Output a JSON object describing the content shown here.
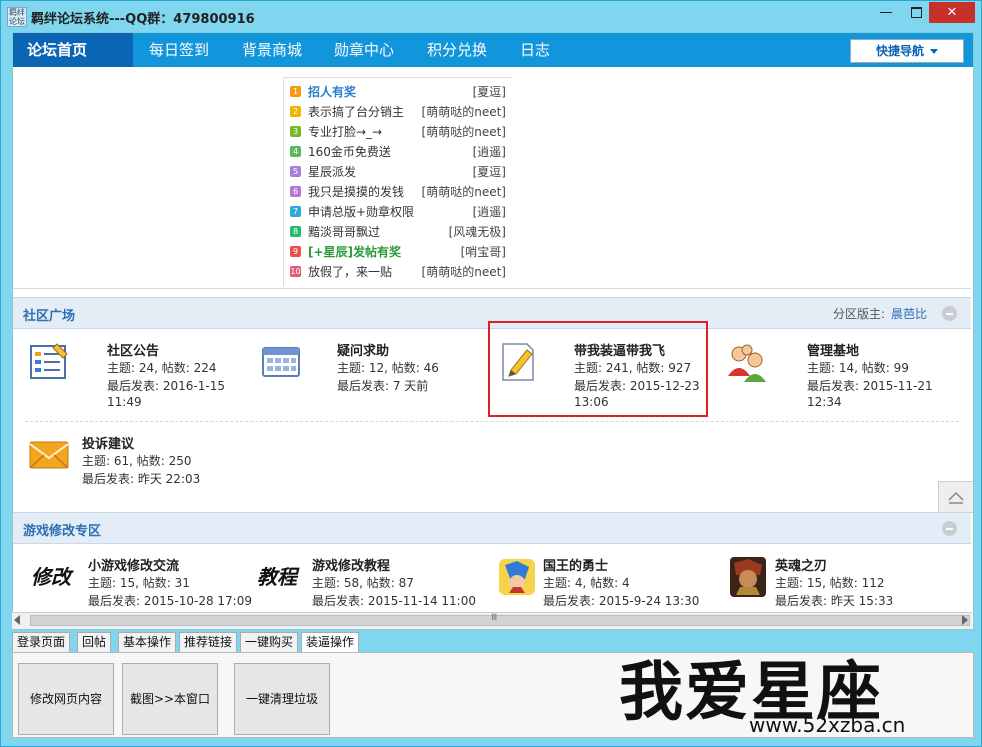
{
  "window": {
    "title": "羁绊论坛系统---QQ群：479800916",
    "icon_text": "羁绊论坛",
    "minimize": "—",
    "close": "✕"
  },
  "nav": {
    "items": [
      "论坛首页",
      "每日签到",
      "背景商城",
      "勋章中心",
      "积分兑换",
      "日志"
    ],
    "quick_nav": "快捷导航"
  },
  "hot_topics": [
    {
      "rank": "1",
      "title": "招人有奖",
      "author": "[夏逗]",
      "style": "blue",
      "color": "#f39c12"
    },
    {
      "rank": "2",
      "title": "表示搞了台分销主",
      "author": "[萌萌哒的neet]",
      "style": "",
      "color": "#f0b400"
    },
    {
      "rank": "3",
      "title": "专业打脸→_→",
      "author": "[萌萌哒的neet]",
      "style": "",
      "color": "#76b82a"
    },
    {
      "rank": "4",
      "title": "160金币免费送",
      "author": "[逍遥]",
      "style": "",
      "color": "#5cb85c"
    },
    {
      "rank": "5",
      "title": "星辰派发",
      "author": "[夏逗]",
      "style": "",
      "color": "#a97ee0"
    },
    {
      "rank": "6",
      "title": "我只是摸摸的发钱",
      "author": "[萌萌哒的neet]",
      "style": "",
      "color": "#b27ad6"
    },
    {
      "rank": "7",
      "title": "申请总版+勋章权限",
      "author": "[逍遥]",
      "style": "",
      "color": "#2fa7d9"
    },
    {
      "rank": "8",
      "title": "黯淡哥哥飘过",
      "author": "[风魂无极]",
      "style": "",
      "color": "#2bb673"
    },
    {
      "rank": "9",
      "title": "[+星辰]发帖有奖",
      "author": "[哨宝哥]",
      "style": "green",
      "color": "#e8504f"
    },
    {
      "rank": "10",
      "title": "放假了，来一贴",
      "author": "[萌萌哒的neet]",
      "style": "",
      "color": "#e05a7a"
    }
  ],
  "section1": {
    "title": "社区广场",
    "moderator_label": "分区版主:",
    "moderator": "晨芭比",
    "forums": [
      {
        "name": "社区公告",
        "stats": "主题: 24, 帖数: 224",
        "last1": "最后发表: 2016-1-15",
        "last2": "11:49",
        "icon": "announcement-icon"
      },
      {
        "name": "疑问求助",
        "stats": "主题: 12, 帖数: 46",
        "last1": "最后发表: 7 天前",
        "last2": "",
        "icon": "calendar-icon"
      },
      {
        "name": "带我装逼带我飞",
        "stats": "主题: 241, 帖数: 927",
        "last1": "最后发表: 2015-12-23",
        "last2": "13:06",
        "icon": "notepad-icon"
      },
      {
        "name": "管理基地",
        "stats": "主题: 14, 帖数: 99",
        "last1": "最后发表: 2015-11-21",
        "last2": "12:34",
        "icon": "users-icon"
      },
      {
        "name": "投诉建议",
        "stats": "主题: 61, 帖数: 250",
        "last1": "最后发表: 昨天 22:03",
        "last2": "",
        "icon": "envelope-icon"
      }
    ]
  },
  "section2": {
    "title": "游戏修改专区",
    "forums": [
      {
        "name": "小游戏修改交流",
        "stats": "主题: 15, 帖数: 31",
        "last1": "最后发表: 2015-10-28 17:09",
        "icon_text": "修改"
      },
      {
        "name": "游戏修改教程",
        "stats": "主题: 58, 帖数: 87",
        "last1": "最后发表: 2015-11-14 11:00",
        "icon_text": "教程"
      },
      {
        "name": "国王的勇士",
        "stats": "主题: 4, 帖数: 4",
        "last1": "最后发表: 2015-9-24 13:30",
        "icon_text": ""
      },
      {
        "name": "英魂之刃",
        "stats": "主题: 15, 帖数: 112",
        "last1": "最后发表: 昨天 15:33",
        "icon_text": ""
      }
    ]
  },
  "scroll_grip": "Ⅲ",
  "tabs": [
    "登录页面",
    "回帖",
    "基本操作",
    "推荐链接",
    "一键购买",
    "装逼操作"
  ],
  "buttons": [
    "修改网页内容",
    "截图>>本窗口",
    "一键清理垃圾"
  ],
  "watermark": {
    "text": "我爱星座",
    "url": "www.52xzba.cn"
  }
}
